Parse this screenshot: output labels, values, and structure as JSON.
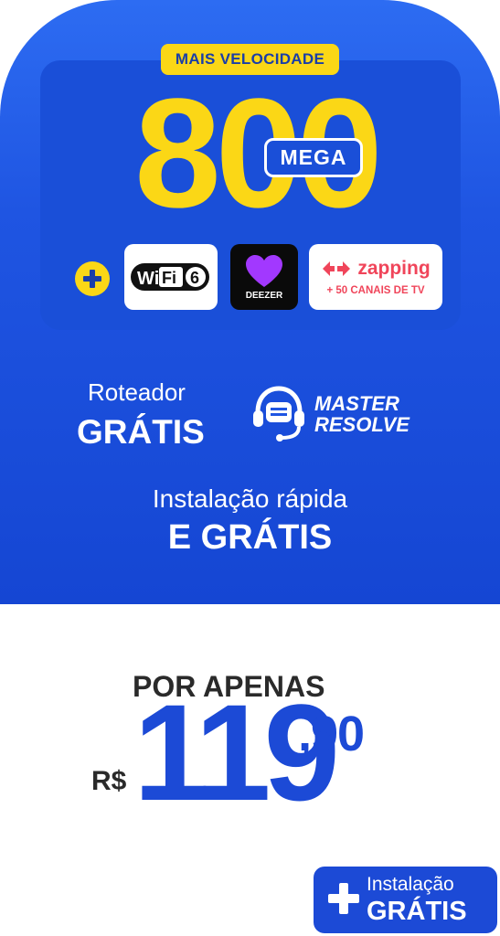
{
  "offer": {
    "badge": "MAIS VELOCIDADE",
    "speed": "800",
    "unit": "MEGA"
  },
  "partners": {
    "wifi": "WiFi 6",
    "deezer": "DEEZER",
    "zapping_name": "zapping",
    "zapping_sub": "+ 50 CANAIS DE TV"
  },
  "benefits": {
    "router_label": "Roteador",
    "router_value": "GRÁTIS",
    "support_line1": "MASTER",
    "support_line2": "RESOLVE",
    "install_label": "Instalação rápida",
    "install_value": "E GRÁTIS"
  },
  "price": {
    "prefix": "POR APENAS",
    "currency": "R$",
    "integer": "119",
    "decimal": ",90"
  },
  "cta": {
    "line1": "Instalação",
    "line2": "GRÁTIS"
  },
  "colors": {
    "brand_blue": "#1c4ad6",
    "accent_yellow": "#fbd716",
    "zapping_red": "#f0455a"
  }
}
